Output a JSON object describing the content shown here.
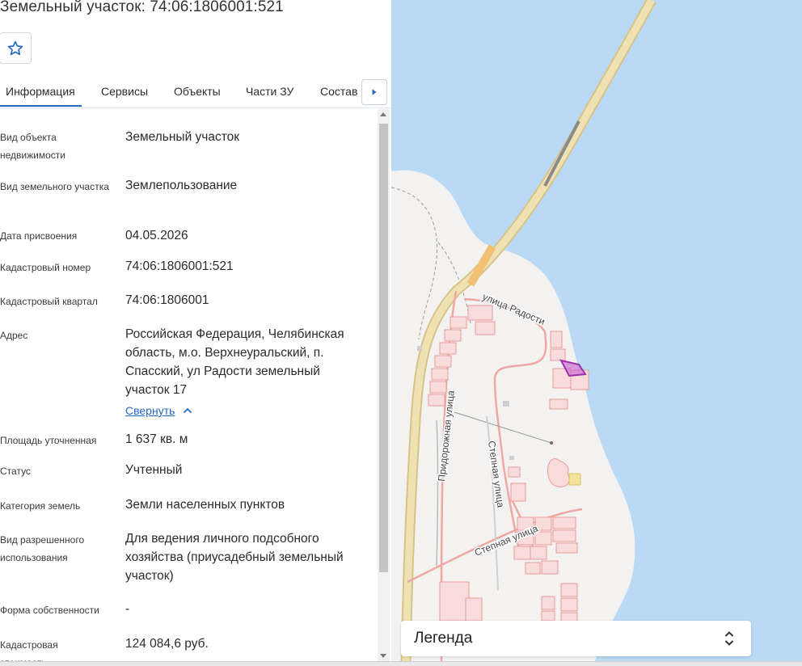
{
  "page": {
    "title": "Земельный участок: 74:06:1806001:521"
  },
  "tabs": [
    {
      "label": "Информация",
      "active": true
    },
    {
      "label": "Сервисы",
      "active": false
    },
    {
      "label": "Объекты",
      "active": false
    },
    {
      "label": "Части ЗУ",
      "active": false
    },
    {
      "label": "Состав",
      "active": false
    }
  ],
  "info": {
    "object_type": {
      "label": "Вид объекта недвижимости",
      "value": "Земельный участок"
    },
    "parcel_type": {
      "label": "Вид земельного участка",
      "value": "Землепользование"
    },
    "assign_date": {
      "label": "Дата присвоения",
      "value": "04.05.2026"
    },
    "cadastral_number": {
      "label": "Кадастровый номер",
      "value": "74:06:1806001:521"
    },
    "cadastral_block": {
      "label": "Кадастровый квартал",
      "value": "74:06:1806001"
    },
    "address": {
      "label": "Адрес",
      "value": "Российская Федерация, Челябинская область, м.о. Верхнеуральский, п. Спасский, ул Радости земельный участок 17"
    },
    "collapse_label": "Свернуть",
    "area": {
      "label": "Площадь уточненная",
      "value": "1 637 кв. м"
    },
    "status": {
      "label": "Статус",
      "value": "Учтенный"
    },
    "land_category": {
      "label": "Категория земель",
      "value": "Земли населенных пунктов"
    },
    "permitted_use": {
      "label": "Вид разрешенного использования",
      "value": "Для ведения личного подсобного хозяйства (приусадебный земельный участок)"
    },
    "ownership": {
      "label": "Форма собственности",
      "value": "-"
    },
    "cadastral_value": {
      "label": "Кадастровая стоимость",
      "value": "124 084,6 руб."
    }
  },
  "map": {
    "streets": {
      "radosti": "улица Радости",
      "pridorozhnaya": "Придорожная улица",
      "stepnaya_vertical": "Степная улица",
      "stepnaya_horizontal": "Степная улица"
    },
    "legend_label": "Легенда",
    "colors": {
      "water": "#b9d9f5",
      "land": "#f3f2f0",
      "road": "#e9d79a",
      "parcel": "#f0a7a5",
      "selected_parcel": "#9b2fae"
    }
  },
  "icons": {
    "favorite": "star-outline-icon",
    "tabs_next": "caret-right-icon",
    "collapse": "chevron-up-icon",
    "legend_toggle": "chevron-up-down-icon"
  }
}
